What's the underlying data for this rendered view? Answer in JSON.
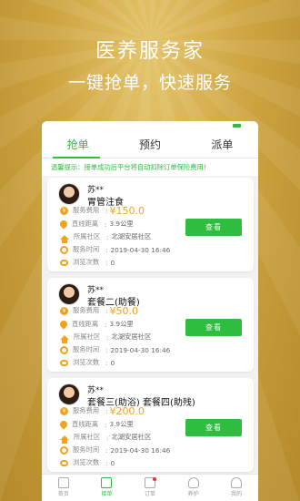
{
  "hero": {
    "title": "医养服务家",
    "subtitle": "一键抢单，快速服务"
  },
  "tabs": [
    {
      "label": "抢单",
      "active": true
    },
    {
      "label": "预约",
      "active": false
    },
    {
      "label": "派单",
      "active": false
    }
  ],
  "notice": "温馨提示：接单成功后平台将自动扣除订单保险费用!",
  "labels": {
    "fee": "服务费用",
    "distance": "直线距离",
    "community": "所属社区",
    "time": "服务时间",
    "views": "浏览次数",
    "colon": ":",
    "view_button": "查看"
  },
  "orders": [
    {
      "name": "苏**",
      "service": "胃管注食",
      "fee": "¥150.0",
      "distance": "3.9公里",
      "community": "北湖安居社区",
      "time": "2019-04-30 16:46",
      "views": "0"
    },
    {
      "name": "苏**",
      "service": "套餐二(助餐)",
      "fee": "¥50.0",
      "distance": "3.9公里",
      "community": "北湖安居社区",
      "time": "2019-04-30 16:46",
      "views": "0"
    },
    {
      "name": "苏**",
      "service": "套餐三(助浴) 套餐四(助残)",
      "fee": "¥200.0",
      "distance": "3.9公里",
      "community": "北湖安居社区",
      "time": "2019-04-30 16:46",
      "views": "0"
    }
  ],
  "bottom_nav": [
    {
      "label": "首页",
      "icon": "home-icon",
      "active": false
    },
    {
      "label": "接单",
      "icon": "clipboard-icon",
      "active": true
    },
    {
      "label": "订单",
      "icon": "order-icon",
      "active": false,
      "badge": true
    },
    {
      "label": "养护",
      "icon": "heart-icon",
      "active": false
    },
    {
      "label": "我的",
      "icon": "user-icon",
      "active": false
    }
  ],
  "colors": {
    "accent": "#2ebd3f",
    "price": "#f1a21f",
    "background": "#cfa542"
  }
}
